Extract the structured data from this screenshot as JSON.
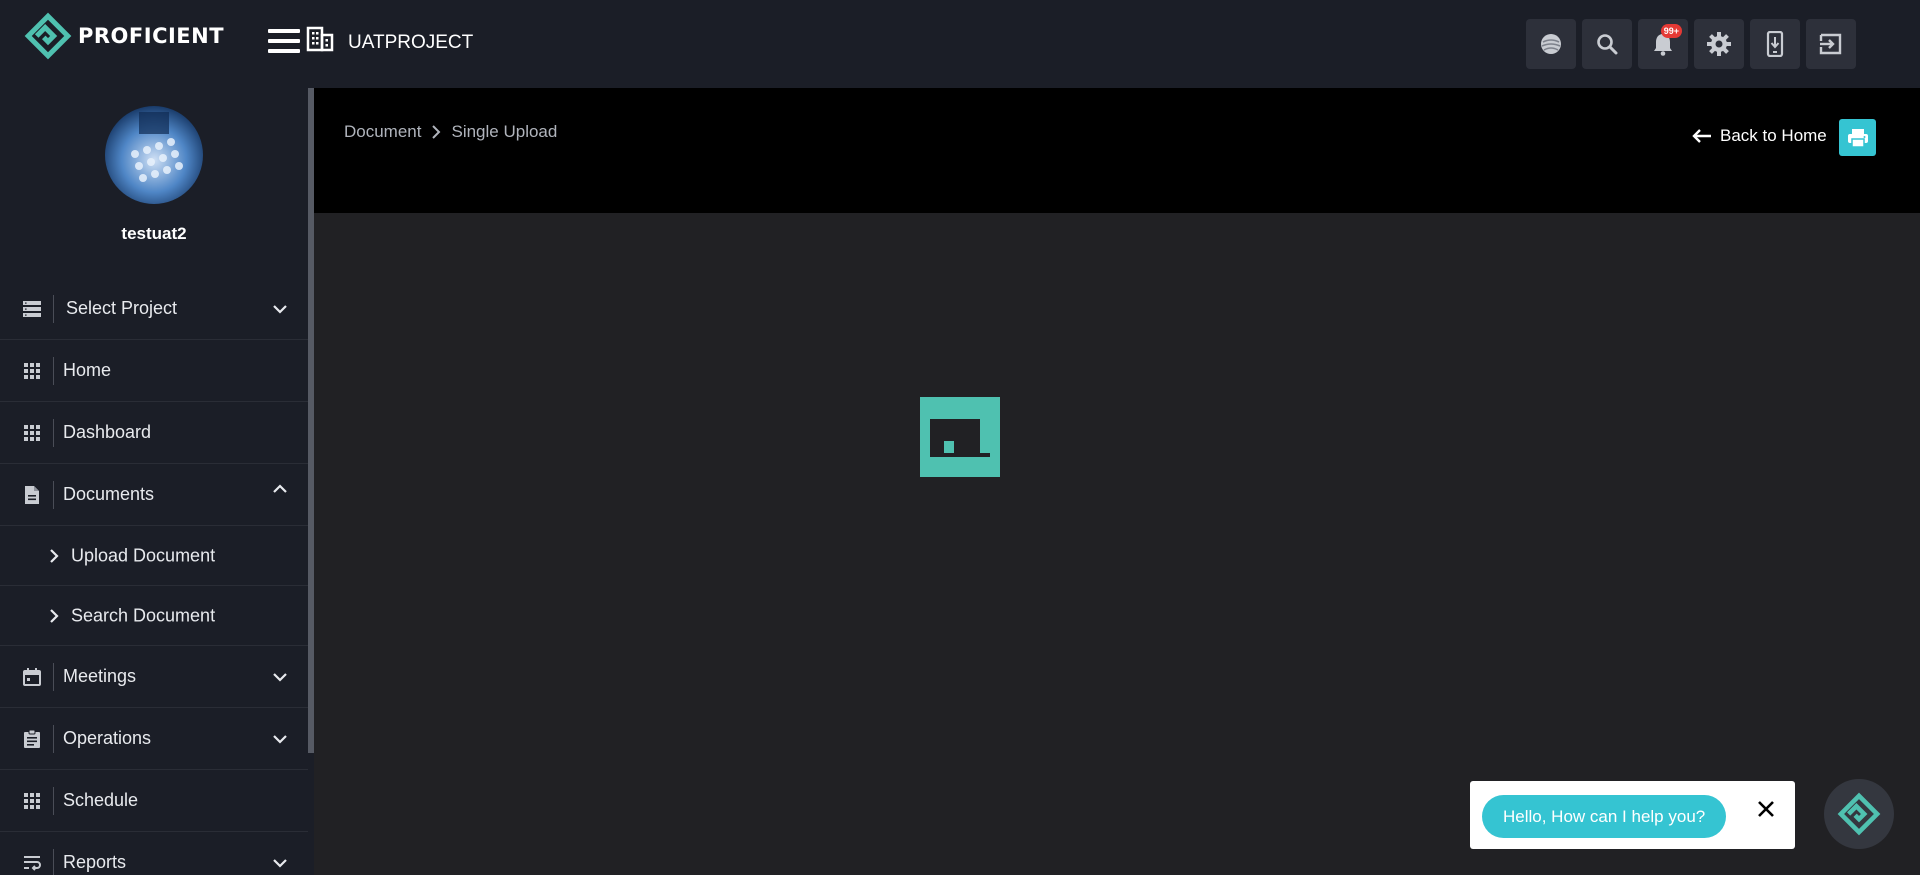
{
  "app": {
    "logo_text": "PROFICIENT",
    "project": "UATPROJECT",
    "accent": "#35c4d2",
    "brand_teal": "#4fc1b0"
  },
  "header": {
    "notification_badge": "99+",
    "actions": [
      "theme-toggle-icon",
      "search-icon",
      "bell-icon",
      "gear-icon",
      "mobile-download-icon",
      "logout-icon"
    ]
  },
  "user": {
    "name": "testuat2"
  },
  "sidebar": {
    "items": [
      {
        "label": "Select Project",
        "icon": "server-list-icon",
        "expanded": false
      },
      {
        "label": "Home",
        "icon": "grid-icon"
      },
      {
        "label": "Dashboard",
        "icon": "grid-icon"
      },
      {
        "label": "Documents",
        "icon": "document-icon",
        "expanded": true,
        "children": [
          {
            "label": "Upload Document"
          },
          {
            "label": "Search Document"
          }
        ]
      },
      {
        "label": "Meetings",
        "icon": "calendar-icon",
        "expanded": false
      },
      {
        "label": "Operations",
        "icon": "clipboard-icon",
        "expanded": false
      },
      {
        "label": "Schedule",
        "icon": "grid-icon"
      },
      {
        "label": "Reports",
        "icon": "wrap-text-icon",
        "expanded": false
      }
    ]
  },
  "page": {
    "breadcrumb": [
      "Document",
      "Single Upload"
    ],
    "back_label": "Back to Home"
  },
  "chat": {
    "greeting": "Hello, How can I help you?"
  }
}
